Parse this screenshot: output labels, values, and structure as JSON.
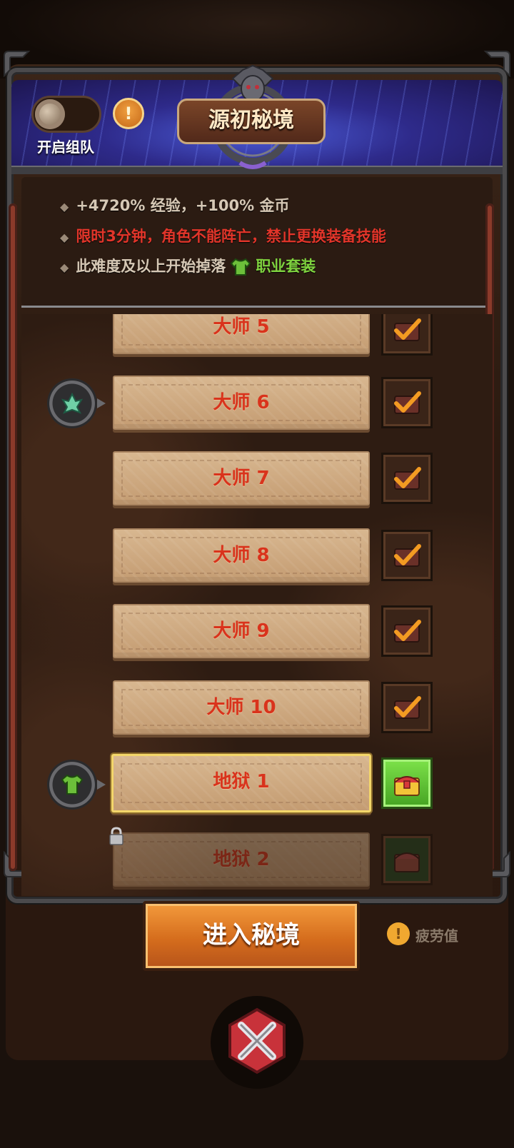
{
  "header": {
    "title": "源初秘境",
    "team_toggle_label": "开启组队"
  },
  "info": {
    "line1": "+4720% 经验，+100% 金币",
    "line2": "限时3分钟，角色不能阵亡，禁止更换装备技能",
    "line3_prefix": "此难度及以上开始掉落",
    "line3_item": "职业套装"
  },
  "levels": [
    {
      "label": "大师 5"
    },
    {
      "label": "大师 6"
    },
    {
      "label": "大师 7"
    },
    {
      "label": "大师 8"
    },
    {
      "label": "大师 9"
    },
    {
      "label": "大师 10"
    },
    {
      "label": "地狱 1"
    },
    {
      "label": "地狱 2"
    }
  ],
  "footer": {
    "enter_label": "进入秘境",
    "fatigue_label": "疲劳值"
  },
  "colors": {
    "accent_orange": "#d56d1d",
    "red_text": "#e2352a",
    "green_text": "#7fd23f",
    "selected_border": "#f3d66a"
  }
}
